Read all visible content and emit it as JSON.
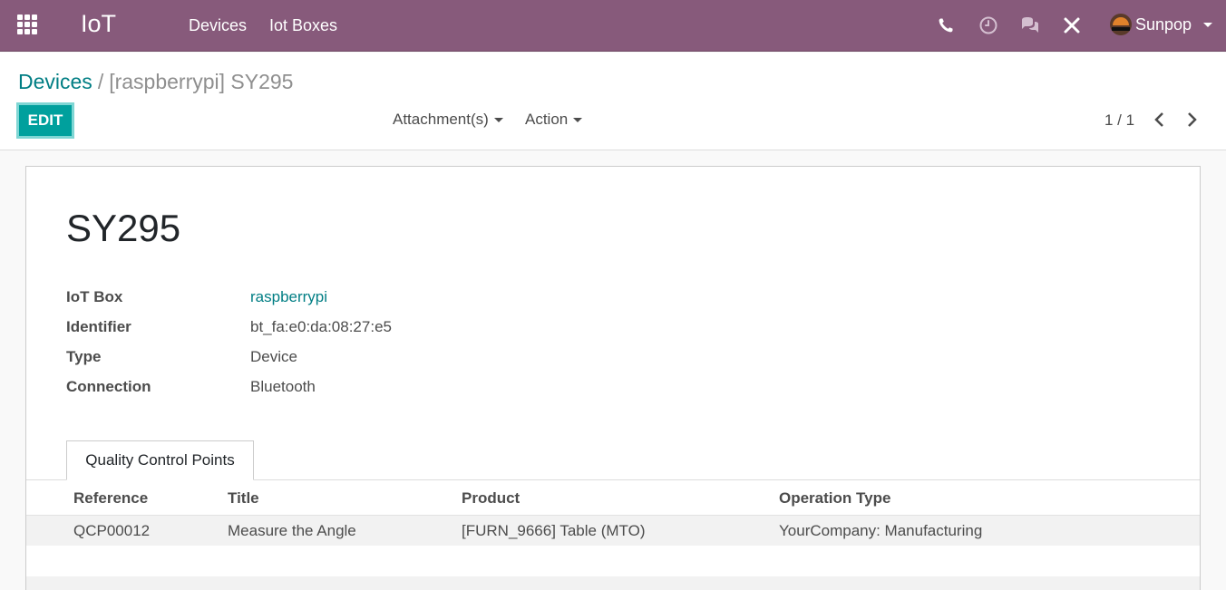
{
  "navbar": {
    "apps_icon": "grid-apps-icon",
    "brand": "IoT",
    "menu": [
      "Devices",
      "Iot Boxes"
    ],
    "icons": [
      "phone-icon",
      "clock-icon",
      "chat-icon",
      "tools-icon"
    ],
    "user_name": "Sunpop"
  },
  "breadcrumb": {
    "parent": "Devices",
    "separator": "/",
    "current": "[raspberrypi] SY295"
  },
  "toolbar": {
    "edit_label": "EDIT",
    "attachments_label": "Attachment(s)",
    "action_label": "Action",
    "pager_value": "1 / 1"
  },
  "record": {
    "title": "SY295",
    "fields": [
      {
        "label": "IoT Box",
        "value": "raspberrypi"
      },
      {
        "label": "Identifier",
        "value": "bt_fa:e0:da:08:27:e5"
      },
      {
        "label": "Type",
        "value": "Device"
      },
      {
        "label": "Connection",
        "value": "Bluetooth"
      }
    ]
  },
  "tabs": [
    {
      "label": "Quality Control Points",
      "active": true
    }
  ],
  "table": {
    "columns": [
      "Reference",
      "Title",
      "Product",
      "Operation Type"
    ],
    "rows": [
      [
        "QCP00012",
        "Measure the Angle",
        "[FURN_9666] Table (MTO)",
        "YourCompany: Manufacturing"
      ]
    ]
  },
  "colors": {
    "navbar": "#875a7b",
    "accent": "#00a09d",
    "link": "#017e84"
  }
}
